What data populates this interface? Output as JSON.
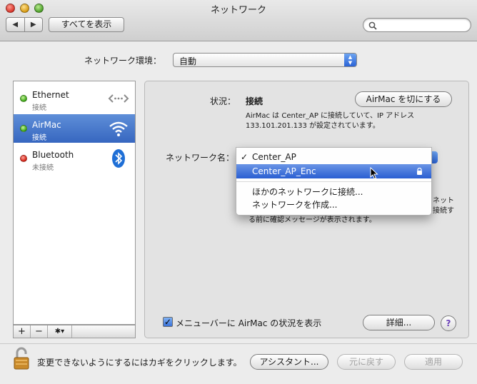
{
  "window": {
    "title": "ネットワーク"
  },
  "toolbar": {
    "back": "◀",
    "forward": "▶",
    "show_all": "すべてを表示",
    "search_placeholder": ""
  },
  "location": {
    "label": "ネットワーク環境：",
    "value": "自動"
  },
  "services": [
    {
      "name": "Ethernet",
      "status": "接続",
      "dot": "green",
      "icon": "ethernet-icon",
      "selected": false
    },
    {
      "name": "AirMac",
      "status": "接続",
      "dot": "green",
      "icon": "wifi-icon",
      "selected": true
    },
    {
      "name": "Bluetooth",
      "status": "未接続",
      "dot": "red",
      "icon": "bluetooth-icon",
      "selected": false
    }
  ],
  "list_buttons": {
    "add": "+",
    "remove": "−",
    "action": "✱▾"
  },
  "detail": {
    "status_label": "状況：",
    "status_value": "接続",
    "turn_off_button": "AirMac を切にする",
    "description_line1": "AirMac は Center_AP に接続していて、IP アドレス",
    "description_line2": "133.101.201.133 が設定されています。",
    "network_name_label": "ネットワーク名：",
    "behind_text_1": "ネット",
    "behind_text_2": "接続す",
    "behind_text_3": "る前に確認メッセージが表示されます。",
    "show_status_checkbox": "メニューバーに AirMac の状況を表示",
    "show_status_checked": true,
    "advanced_button": "詳細...",
    "help_button": "?"
  },
  "network_menu": {
    "items": [
      {
        "label": "Center_AP",
        "checked": true,
        "highlighted": false,
        "locked": false
      },
      {
        "label": "Center_AP_Enc",
        "checked": false,
        "highlighted": true,
        "locked": true
      }
    ],
    "actions": [
      "ほかのネットワークに接続...",
      "ネットワークを作成..."
    ]
  },
  "footer": {
    "lock_text": "変更できないようにするにはカギをクリックします。",
    "assistant_button": "アシスタント...",
    "revert_button": "元に戻す",
    "apply_button": "適用"
  },
  "colors": {
    "selection": "#3767c0",
    "menu_highlight": "#2a5fd2",
    "status_connected": "#3aa514",
    "status_disconnected": "#d31f12"
  }
}
